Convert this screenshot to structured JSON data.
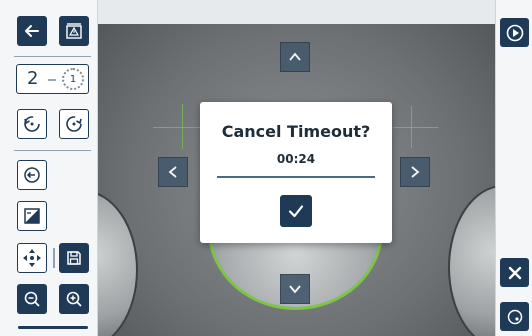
{
  "dialog": {
    "title": "Cancel Timeout?",
    "timer": "00:24"
  },
  "sidebar": {
    "counter_value": "2",
    "dial_value": "1"
  },
  "icons": {
    "back": "arrow-left-icon",
    "alert": "warning-screen-icon",
    "rotate_ccw": "rotate-ccw-icon",
    "rotate_cw": "rotate-cw-icon",
    "login": "enter-icon",
    "contrast": "contrast-icon",
    "move": "move-arrows-icon",
    "save": "save-icon",
    "zoom_out": "zoom-out-icon",
    "zoom_in": "zoom-in-icon",
    "play": "play-circle-icon",
    "close": "close-icon",
    "focus": "focus-icon",
    "check": "check-icon",
    "nav_up": "chevron-up-icon",
    "nav_down": "chevron-down-icon",
    "nav_left": "chevron-left-icon",
    "nav_right": "chevron-right-icon"
  },
  "colors": {
    "primary": "#1e3a56",
    "accent_ring": "#7ec447",
    "nav_button": "#455a6c"
  }
}
